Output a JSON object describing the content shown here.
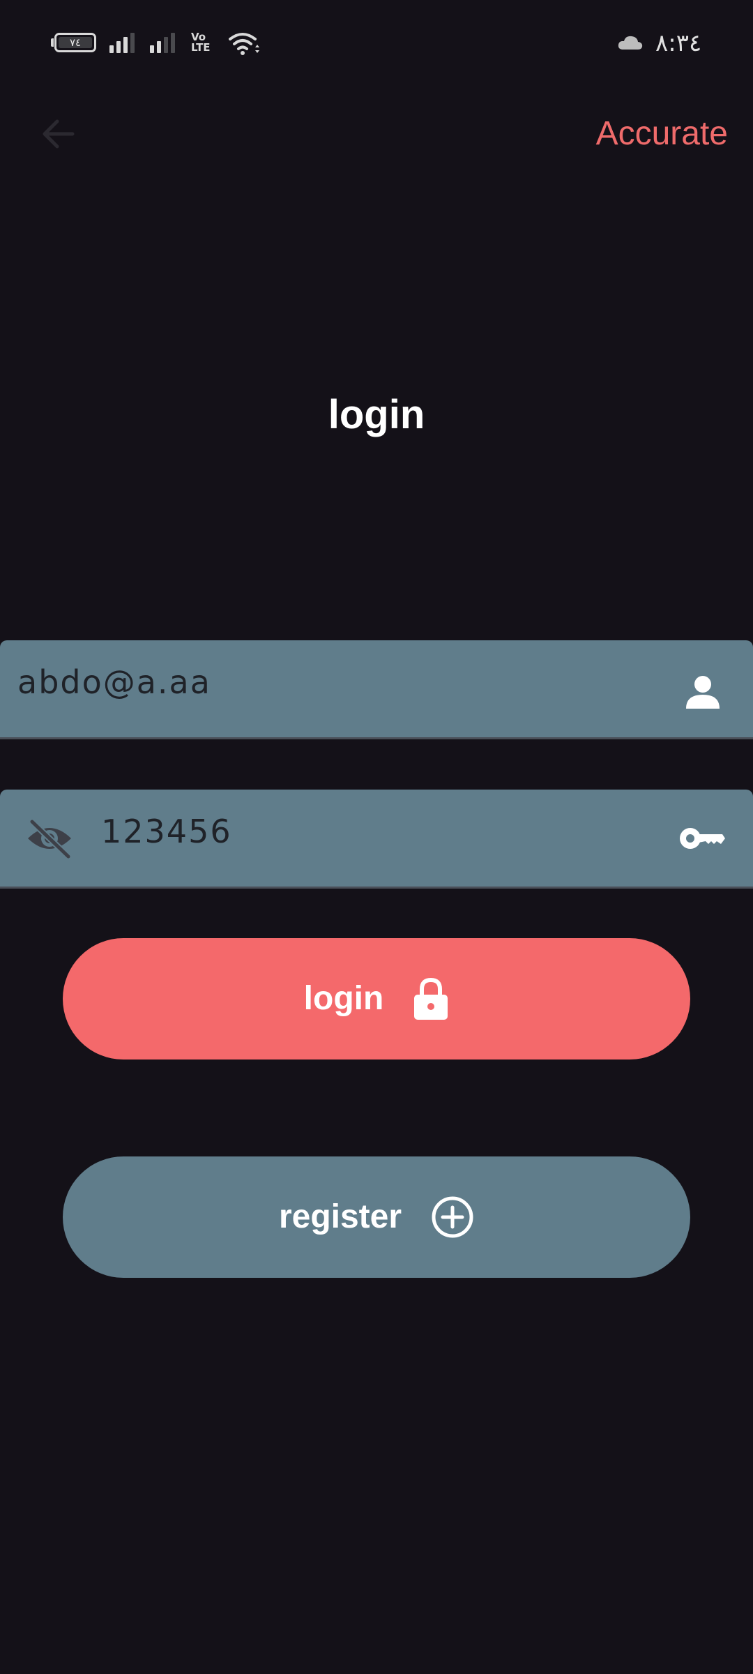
{
  "status_bar": {
    "battery_level": "٧٤",
    "volte_top": "Vo",
    "volte_bottom": "LTE",
    "time": "٨:٣٤",
    "icons": [
      "battery-icon",
      "signal-icon",
      "signal-icon",
      "volte-icon",
      "wifi-icon",
      "cloud-icon"
    ]
  },
  "app_bar": {
    "back_icon": "arrow-left-icon",
    "action_label": "Accurate"
  },
  "page": {
    "title": "login"
  },
  "form": {
    "email": {
      "value": "abdo@a.aa",
      "icon": "person-icon"
    },
    "password": {
      "value": "123456",
      "toggle_icon": "eye-off-icon",
      "icon": "key-icon"
    }
  },
  "buttons": {
    "login": {
      "label": "login",
      "icon": "lock-icon"
    },
    "register": {
      "label": "register",
      "icon": "plus-circle-icon"
    }
  },
  "colors": {
    "background": "#141118",
    "accent": "#f4696b",
    "field": "#607d8b"
  }
}
